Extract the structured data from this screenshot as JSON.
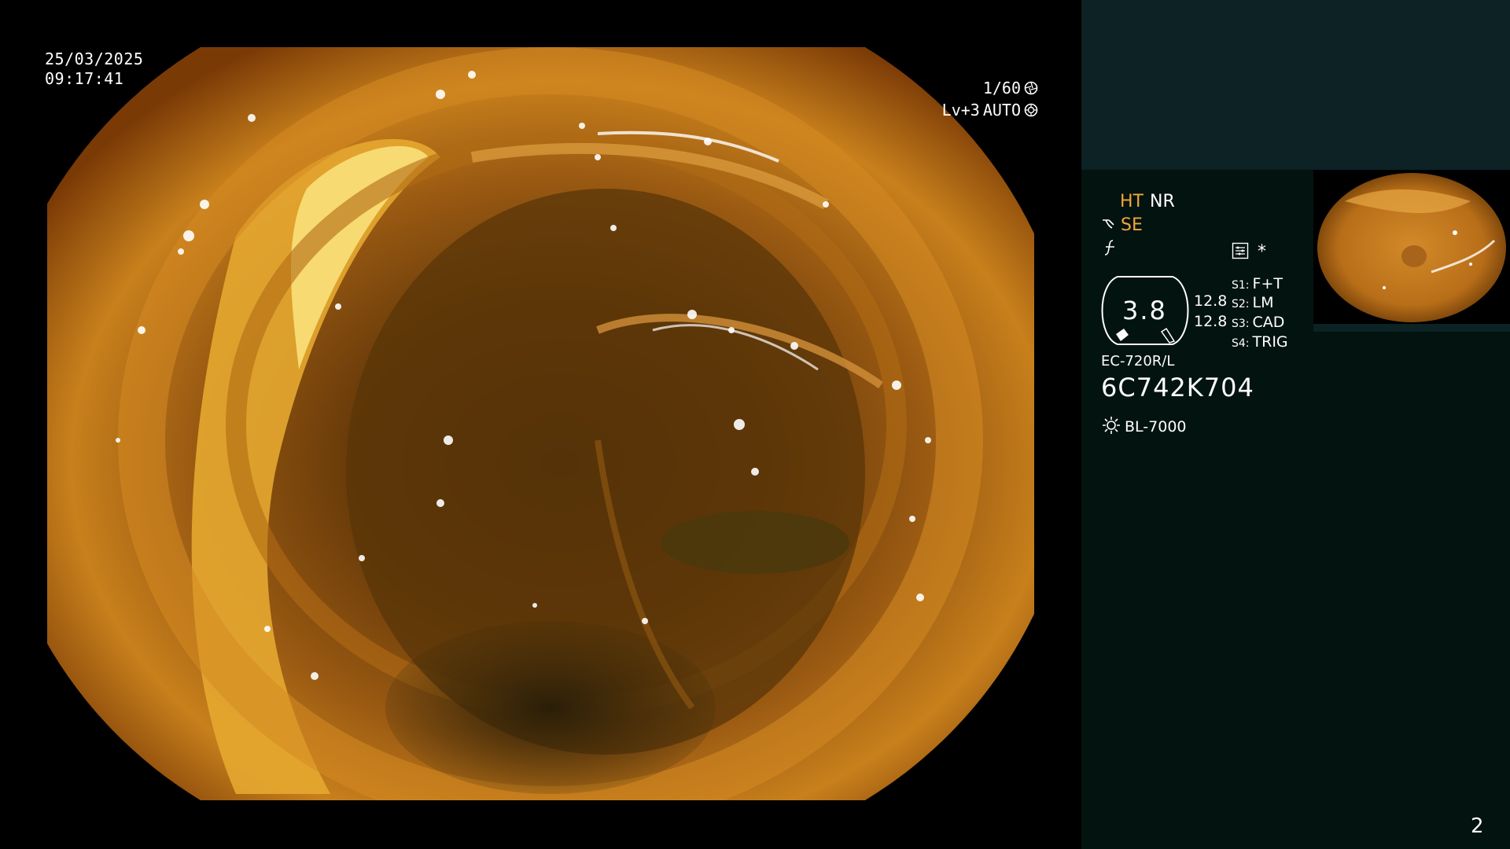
{
  "overlay": {
    "date": "25/03/2025",
    "time": "09:17:41",
    "shutter": "1/60",
    "shutter_icon": "shutter-icon",
    "iris_level": "Lv+3",
    "iris_mode": "AUTO",
    "iris_icon": "iris-icon"
  },
  "panel": {
    "ht": "HT",
    "nr": "NR",
    "se": "SE",
    "se_icon": "structure-enhancement-icon",
    "f_icon": "function-icon",
    "mode_icon": "record-mode-icon",
    "star": "*",
    "gauge_value": "3.8",
    "value_a": "12.8",
    "value_b": "12.8",
    "slots": [
      {
        "key": "S1:",
        "value": "F+T"
      },
      {
        "key": "S2:",
        "value": "LM"
      },
      {
        "key": "S3:",
        "value": "CAD"
      },
      {
        "key": "S4:",
        "value": "TRIG"
      }
    ],
    "scope_model": "EC-720R/L",
    "scope_serial": "6C742K704",
    "light_icon": "light-source-icon",
    "light_source": "BL-7000",
    "page_number": "2"
  },
  "colors": {
    "accent_orange": "#f1a63a",
    "panel_bg": "#031310",
    "panel_top_band": "#0c2224"
  }
}
